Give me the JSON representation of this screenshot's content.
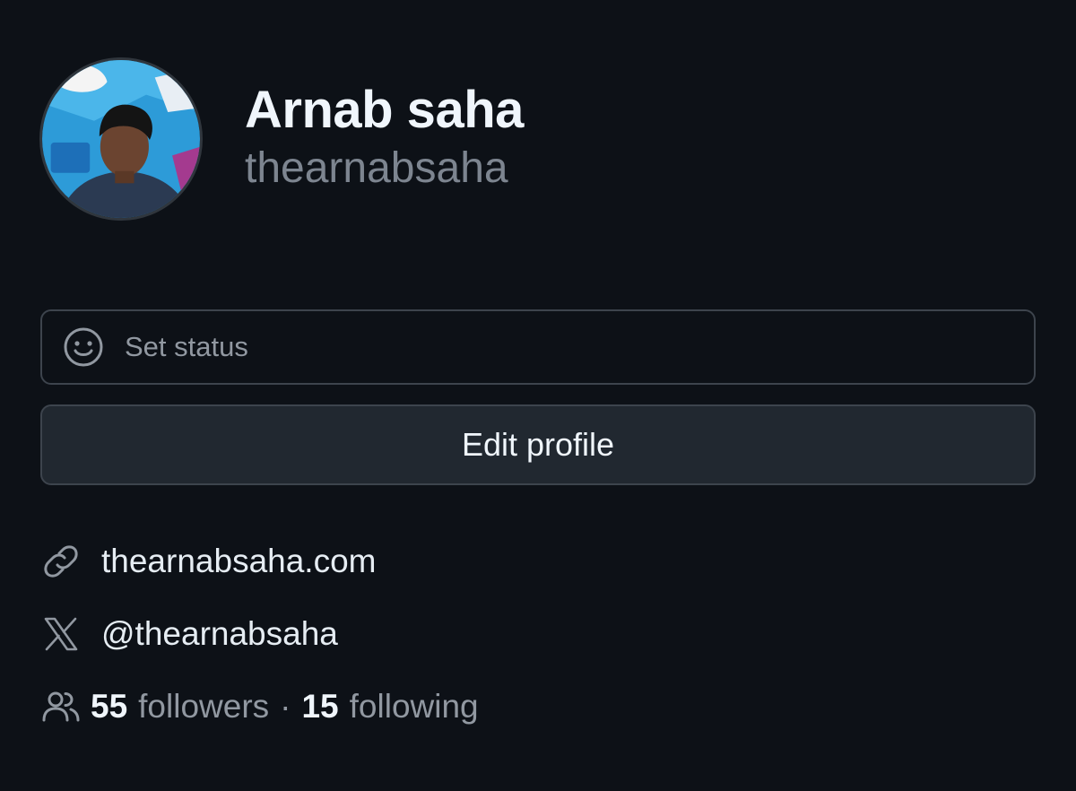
{
  "profile": {
    "display_name": "Arnab saha",
    "username": "thearnabsaha",
    "avatar_icon": "user-avatar-photo"
  },
  "status": {
    "label": "Set status",
    "icon": "smiley-icon"
  },
  "edit_profile": {
    "label": "Edit profile"
  },
  "links": {
    "website": {
      "icon": "link-icon",
      "text": "thearnabsaha.com"
    },
    "twitter": {
      "icon": "x-logo-icon",
      "text": "@thearnabsaha"
    }
  },
  "social": {
    "icon": "people-icon",
    "followers_count": "55",
    "followers_label": "followers",
    "separator": "·",
    "following_count": "15",
    "following_label": "following"
  },
  "colors": {
    "background": "#0d1117",
    "border": "#3d444d",
    "button_bg": "#212830",
    "muted_text": "#9198a1",
    "text": "#e6edf3"
  }
}
